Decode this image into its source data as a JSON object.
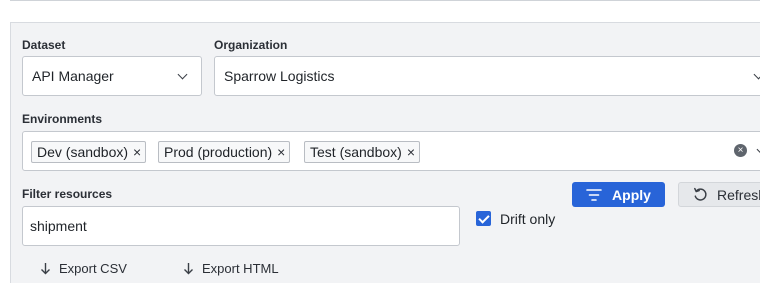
{
  "dataset": {
    "label": "Dataset",
    "value": "API Manager"
  },
  "organization": {
    "label": "Organization",
    "value": "Sparrow Logistics"
  },
  "environments": {
    "label": "Environments",
    "chips": [
      {
        "label": "Dev (sandbox)"
      },
      {
        "label": "Prod (production)"
      },
      {
        "label": "Test (sandbox)"
      }
    ]
  },
  "filter": {
    "label": "Filter resources",
    "value": "shipment"
  },
  "drift_only": {
    "label": "Drift only",
    "checked": true
  },
  "actions": {
    "apply": "Apply",
    "refresh": "Refresh"
  },
  "exports": {
    "csv": "Export CSV",
    "html": "Export HTML"
  },
  "colors": {
    "primary": "#2864d8",
    "panel": "#f2f3f5"
  },
  "icons": {
    "remove": "×",
    "clear": "×",
    "filter_icon": "filter-lines",
    "refresh_icon": "refresh-arrow",
    "download_icon": "download-arrow"
  }
}
